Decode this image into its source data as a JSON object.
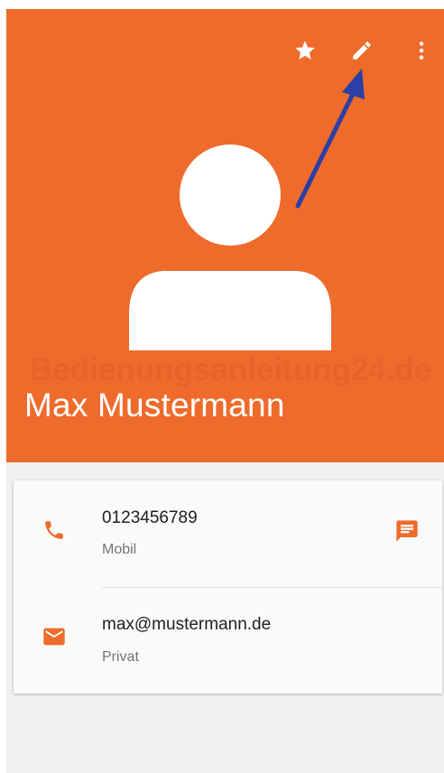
{
  "header": {
    "background_color": "#ee6b2b",
    "actions": [
      {
        "name": "star-icon",
        "label": "Favorite"
      },
      {
        "name": "edit-icon",
        "label": "Edit"
      },
      {
        "name": "more-vert-icon",
        "label": "More options"
      }
    ],
    "avatar_icon": "person-silhouette-icon",
    "contact_name": "Max Mustermann",
    "watermark_text": "Bedienungsanleitung24.de",
    "annotation_arrow_color": "#2a3fa6"
  },
  "details": {
    "accent_color": "#ee6b2b",
    "phone": {
      "icon": "phone-icon",
      "number": "0123456789",
      "type": "Mobil",
      "action_icon": "message-icon"
    },
    "email": {
      "icon": "email-icon",
      "address": "max@mustermann.de",
      "type": "Privat"
    }
  }
}
